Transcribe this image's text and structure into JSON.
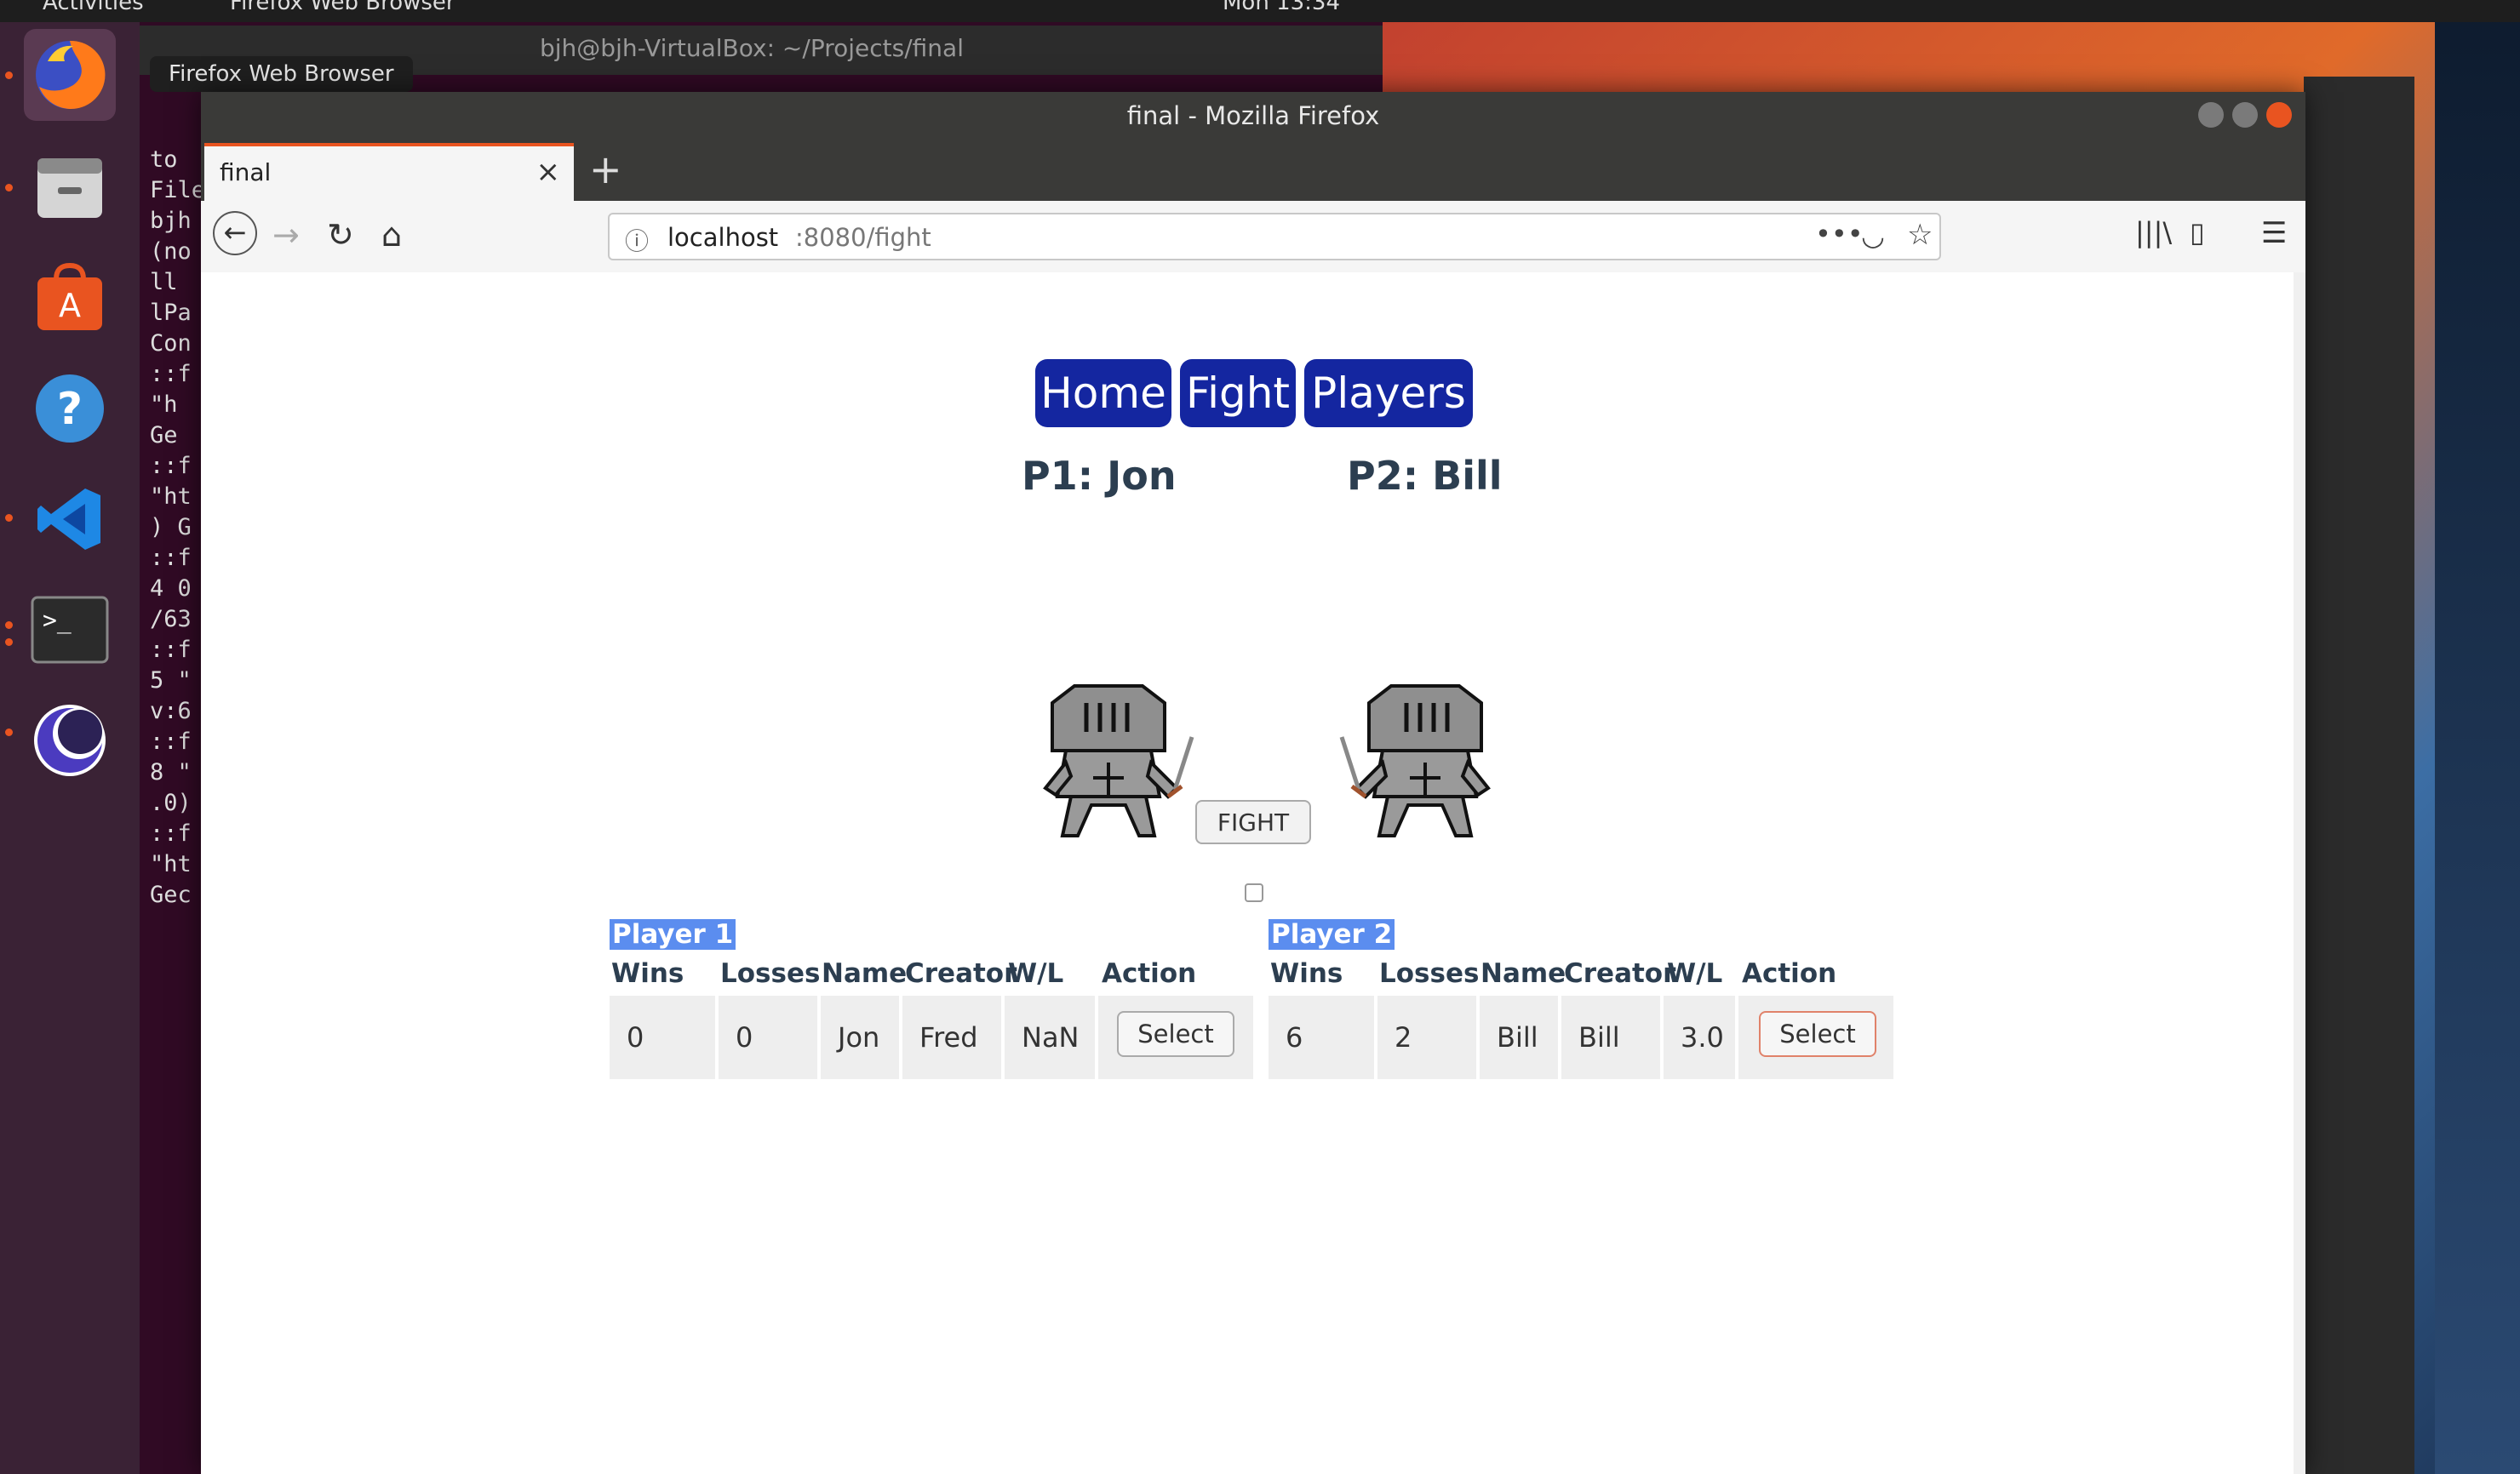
{
  "topbar": {
    "activities": "Activities",
    "app_menu": "Firefox Web Browser",
    "clock": "Mon 13:34"
  },
  "dock": {
    "tooltip": "Firefox Web Browser",
    "items": [
      "firefox-icon",
      "files-icon",
      "software-icon",
      "help-icon",
      "vscode-icon",
      "terminal-icon",
      "eclipse-icon"
    ]
  },
  "terminal": {
    "title": "bjh@bjh-VirtualBox: ~/Projects/final",
    "lines": [
      "to",
      "",
      "",
      "",
      "",
      "File",
      "bjh",
      "(no",
      "ll",
      "lPa",
      "Con",
      "::f",
      "\"h",
      "Ge",
      "::f",
      "\"ht",
      ") G",
      "::f",
      "4 0",
      "/63",
      "::f",
      "5 \"",
      "v:6",
      "::f",
      "8 \"",
      ".0)",
      "::f",
      "\"ht",
      "Gec"
    ]
  },
  "browser": {
    "window_title": "final - Mozilla Firefox",
    "tab_title": "final",
    "url_host": "localhost",
    "url_path": ":8080/fight"
  },
  "page": {
    "nav": [
      "Home",
      "Fight",
      "Players"
    ],
    "p1_label": "P1: Jon",
    "p2_label": "P2: Bill",
    "fight_button": "FIGHT",
    "player1": {
      "caption": "Player 1",
      "headers": [
        "Wins",
        "Losses",
        "Name",
        "Creator",
        "W/L",
        "Action"
      ],
      "row": [
        "0",
        "0",
        "Jon",
        "Fred",
        "NaN"
      ],
      "select": "Select"
    },
    "player2": {
      "caption": "Player 2",
      "headers": [
        "Wins",
        "Losses",
        "Name",
        "Creator",
        "W/L",
        "Action"
      ],
      "row": [
        "6",
        "2",
        "Bill",
        "Bill",
        "3.0"
      ],
      "select": "Select"
    }
  },
  "colors": {
    "nav_button": "#1426a0",
    "caption_highlight": "#5b8def",
    "ubuntu_accent": "#e95420"
  }
}
